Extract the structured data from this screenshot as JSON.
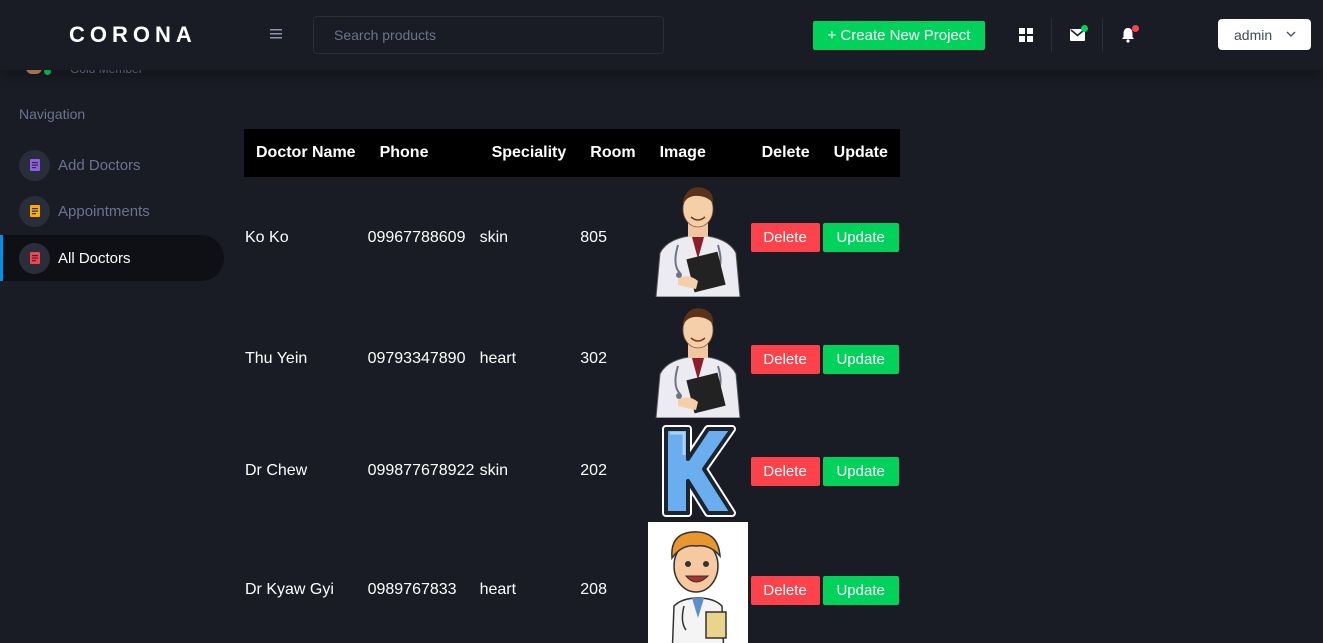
{
  "brand": "CORONA",
  "profile": {
    "subtitle": "Gold Member"
  },
  "search": {
    "placeholder": "Search products"
  },
  "toolbar": {
    "create_label": "+ Create New Project"
  },
  "user": {
    "name": "admin"
  },
  "sidebar": {
    "caption": "Navigation",
    "items": [
      {
        "label": "Add Doctors",
        "icon": "doc-icon",
        "color": "#8f5fe8"
      },
      {
        "label": "Appointments",
        "icon": "doc-icon",
        "color": "#ffab00"
      },
      {
        "label": "All Doctors",
        "icon": "doc-icon",
        "color": "#fc424a",
        "active": true
      }
    ]
  },
  "table": {
    "headers": [
      "Doctor Name",
      "Phone",
      "Speciality",
      "Room",
      "Image",
      "Delete",
      "Update"
    ],
    "rows": [
      {
        "name": "Ko Ko",
        "phone": "09967788609",
        "speciality": "skin",
        "room": "805",
        "image": "doctor-cartoon"
      },
      {
        "name": "Thu Yein",
        "phone": "09793347890",
        "speciality": "heart",
        "room": "302",
        "image": "doctor-cartoon"
      },
      {
        "name": "Dr Chew",
        "phone": "099877678922",
        "speciality": "skin",
        "room": "202",
        "image": "letter-k"
      },
      {
        "name": "Dr Kyaw Gyi",
        "phone": "0989767833",
        "speciality": "heart",
        "room": "208",
        "image": "doctor-cartoon-young"
      }
    ],
    "delete_label": "Delete",
    "update_label": "Update"
  },
  "colors": {
    "accent_green": "#00d25b",
    "danger": "#fc424a",
    "bg": "#191c24",
    "active_border": "#0090e7"
  }
}
